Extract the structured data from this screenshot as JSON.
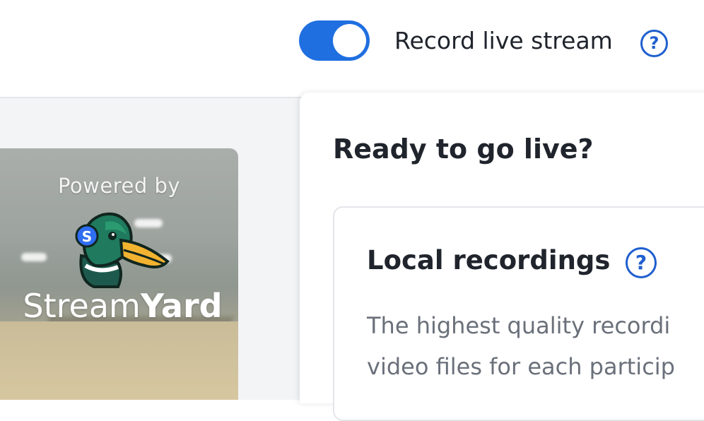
{
  "header": {
    "record_toggle": {
      "label": "Record live stream",
      "enabled": true
    },
    "help_icon": "question-circle-icon"
  },
  "stage": {
    "watermark": {
      "powered_by": "Powered by",
      "brand_light": "Stream",
      "brand_bold": "Yard",
      "logo_icon": "duck-logo-icon"
    }
  },
  "panel": {
    "title": "Ready to go live?",
    "local_recordings": {
      "title": "Local recordings",
      "help_icon": "question-circle-icon",
      "description_line1": "The highest quality recordi",
      "description_line2": "video files for each particip"
    }
  },
  "colors": {
    "accent": "#1f6fe0",
    "help_icon": "#1f5fcf",
    "text": "#20242c",
    "muted_text": "#6a707a"
  }
}
